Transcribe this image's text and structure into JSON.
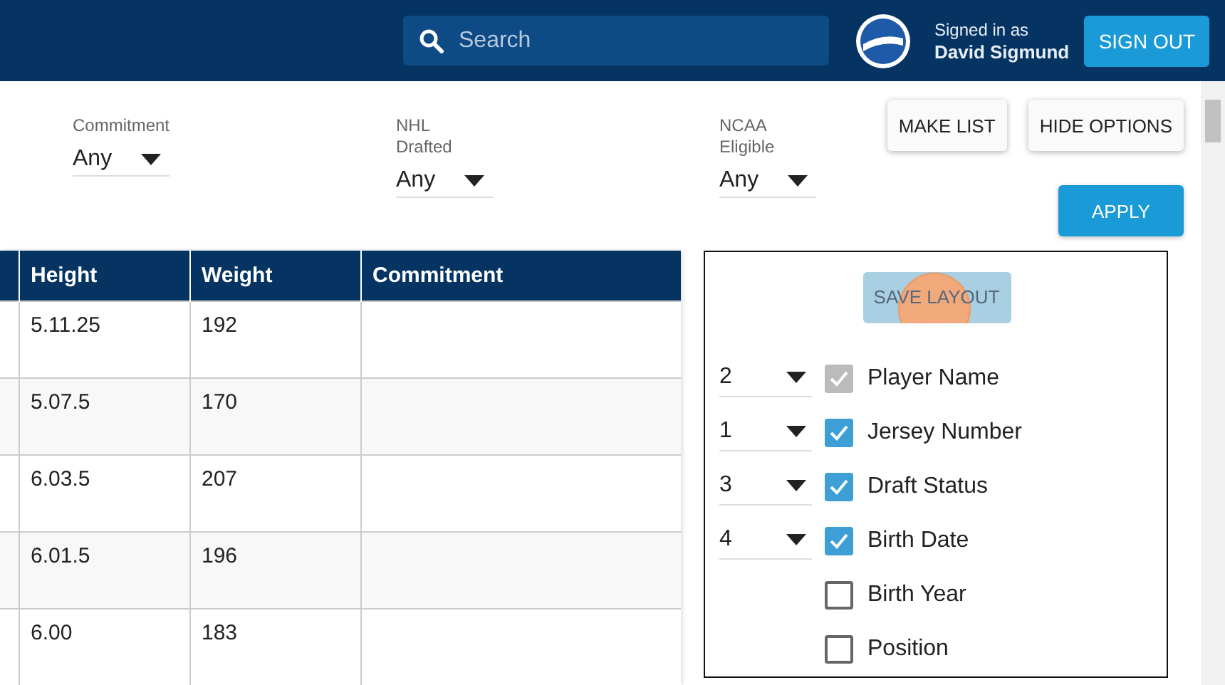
{
  "header": {
    "search": {
      "placeholder": "Search"
    },
    "signed_in_label": "Signed in as",
    "user_name": "David Sigmund",
    "sign_out": "SIGN OUT"
  },
  "filters": [
    {
      "label": "Commitment",
      "value": "Any"
    },
    {
      "label": "NHL\nDrafted",
      "value": "Any"
    },
    {
      "label": "NCAA\nEligible",
      "value": "Any"
    }
  ],
  "actions": {
    "make_list": "MAKE LIST",
    "hide_options": "HIDE OPTIONS",
    "apply": "APPLY"
  },
  "table": {
    "columns": [
      "Height",
      "Weight",
      "Commitment"
    ],
    "rows": [
      {
        "cells": [
          "5.11.25",
          "192"
        ]
      },
      {
        "cells": [
          "5.07.5",
          "170"
        ]
      },
      {
        "cells": [
          "6.03.5",
          "207"
        ]
      },
      {
        "cells": [
          "6.01.5",
          "196"
        ]
      },
      {
        "cells": [
          "6.00",
          "183"
        ]
      }
    ]
  },
  "layout_panel": {
    "save_layout": {
      "label": "SAVE LAYOUT",
      "disabled": true
    },
    "fields": [
      {
        "order": "2",
        "label": "Player Name",
        "checked": true,
        "disabled": true
      },
      {
        "order": "1",
        "label": "Jersey Number",
        "checked": true,
        "disabled": false
      },
      {
        "order": "3",
        "label": "Draft Status",
        "checked": true,
        "disabled": false
      },
      {
        "order": "4",
        "label": "Birth Date",
        "checked": true,
        "disabled": false
      },
      {
        "label": "Birth Year",
        "checked": false,
        "disabled": false
      },
      {
        "label": "Position",
        "checked": false,
        "disabled": false
      }
    ]
  }
}
